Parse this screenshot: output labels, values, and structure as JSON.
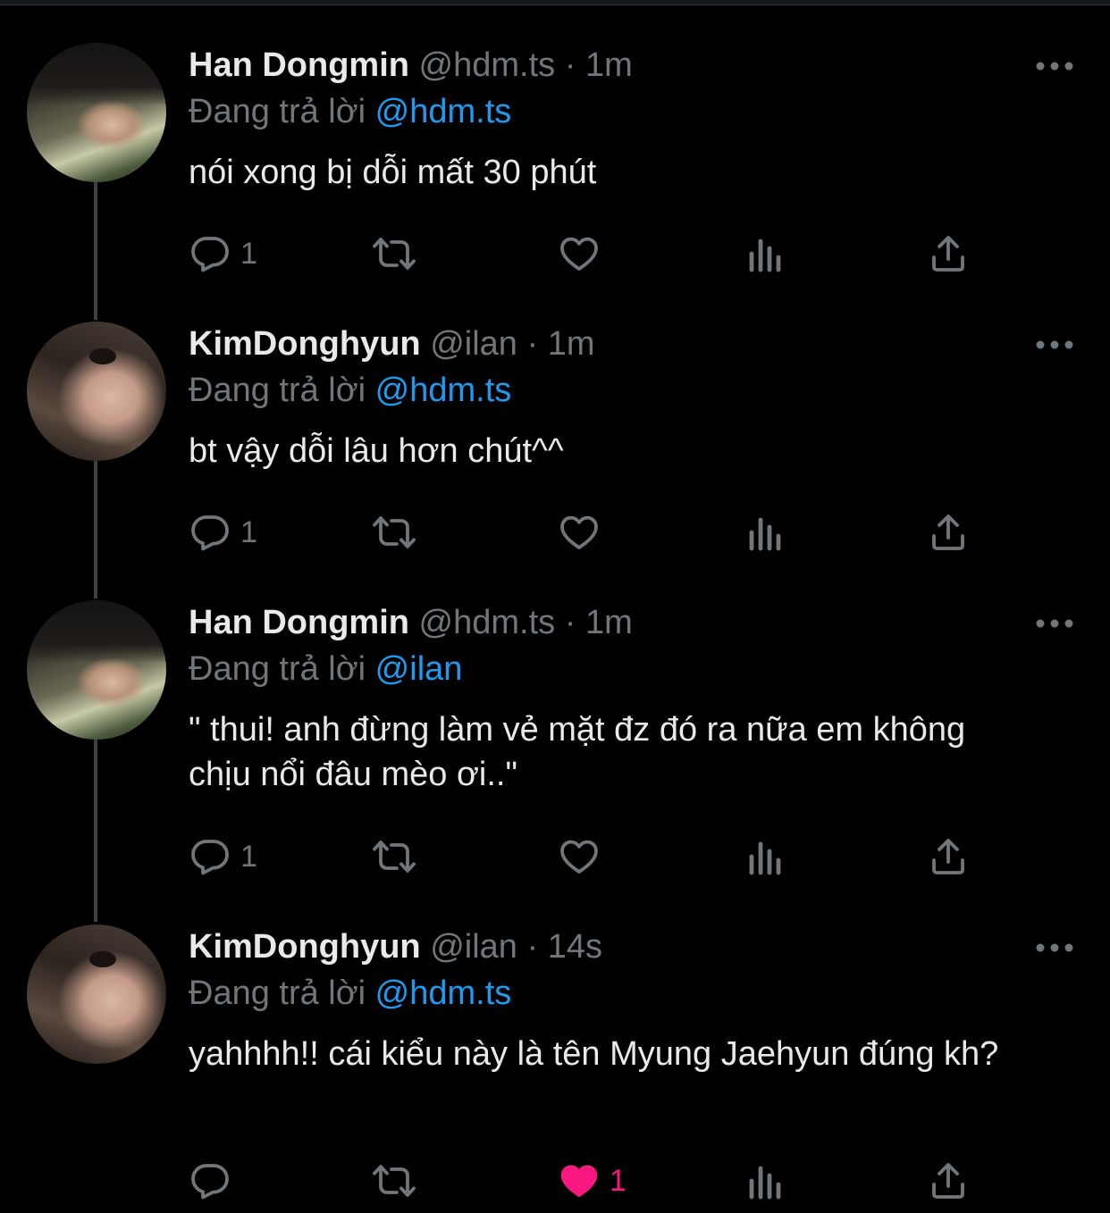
{
  "tweets": [
    {
      "avatar": "han-dongmin-avatar",
      "name": "Han Dongmin",
      "handle": "@hdm.ts",
      "time": "1m",
      "replying_label": "Đang trả lời",
      "replying_to": "@hdm.ts",
      "text": "nói xong bị dỗi mất 30 phút",
      "reply_count": "1",
      "like_count": "",
      "liked": false
    },
    {
      "avatar": "kim-donghyun-avatar",
      "name": "KimDonghyun",
      "handle": "@ilan",
      "time": "1m",
      "replying_label": "Đang trả lời",
      "replying_to": "@hdm.ts",
      "text": "bt vậy dỗi lâu hơn chút^^",
      "reply_count": "1",
      "like_count": "",
      "liked": false
    },
    {
      "avatar": "han-dongmin-avatar",
      "name": "Han Dongmin",
      "handle": "@hdm.ts",
      "time": "1m",
      "replying_label": "Đang trả lời",
      "replying_to": "@ilan",
      "text": "\" thui! anh đừng làm vẻ mặt đz đó ra nữa em không chịu nổi đâu mèo ơi..\"",
      "reply_count": "1",
      "like_count": "",
      "liked": false
    },
    {
      "avatar": "kim-donghyun-avatar",
      "name": "KimDonghyun",
      "handle": "@ilan",
      "time": "14s",
      "replying_label": "Đang trả lời",
      "replying_to": "@hdm.ts",
      "text": "yahhhh!! cái kiểu này là tên Myung Jaehyun đúng kh?",
      "reply_count": "",
      "like_count": "1",
      "liked": true
    }
  ],
  "separator": "·",
  "icons": {
    "reply": "reply-icon",
    "retweet": "retweet-icon",
    "like": "heart-icon",
    "views": "analytics-icon",
    "share": "share-icon",
    "more": "more-icon"
  },
  "colors": {
    "background": "#000000",
    "text": "#e7e9ea",
    "muted": "#71767b",
    "link": "#1d9bf0",
    "liked": "#f91880",
    "thread_line": "#3e4144"
  }
}
